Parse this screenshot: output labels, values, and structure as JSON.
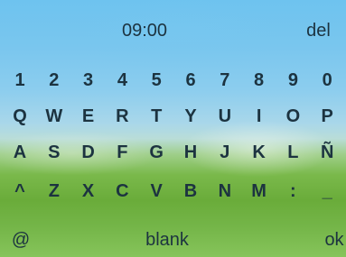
{
  "header": {
    "time": "09:00",
    "delete_label": "del"
  },
  "keyboard": {
    "rows": [
      [
        "1",
        "2",
        "3",
        "4",
        "5",
        "6",
        "7",
        "8",
        "9",
        "0"
      ],
      [
        "Q",
        "W",
        "E",
        "R",
        "T",
        "Y",
        "U",
        "I",
        "O",
        "P"
      ],
      [
        "A",
        "S",
        "D",
        "F",
        "G",
        "H",
        "J",
        "K",
        "L",
        "Ñ"
      ],
      [
        "^",
        "Z",
        "X",
        "C",
        "V",
        "B",
        "N",
        "M",
        ":",
        "_"
      ]
    ],
    "bottom": {
      "at_label": "@",
      "blank_label": "blank",
      "ok_label": "ok"
    }
  }
}
